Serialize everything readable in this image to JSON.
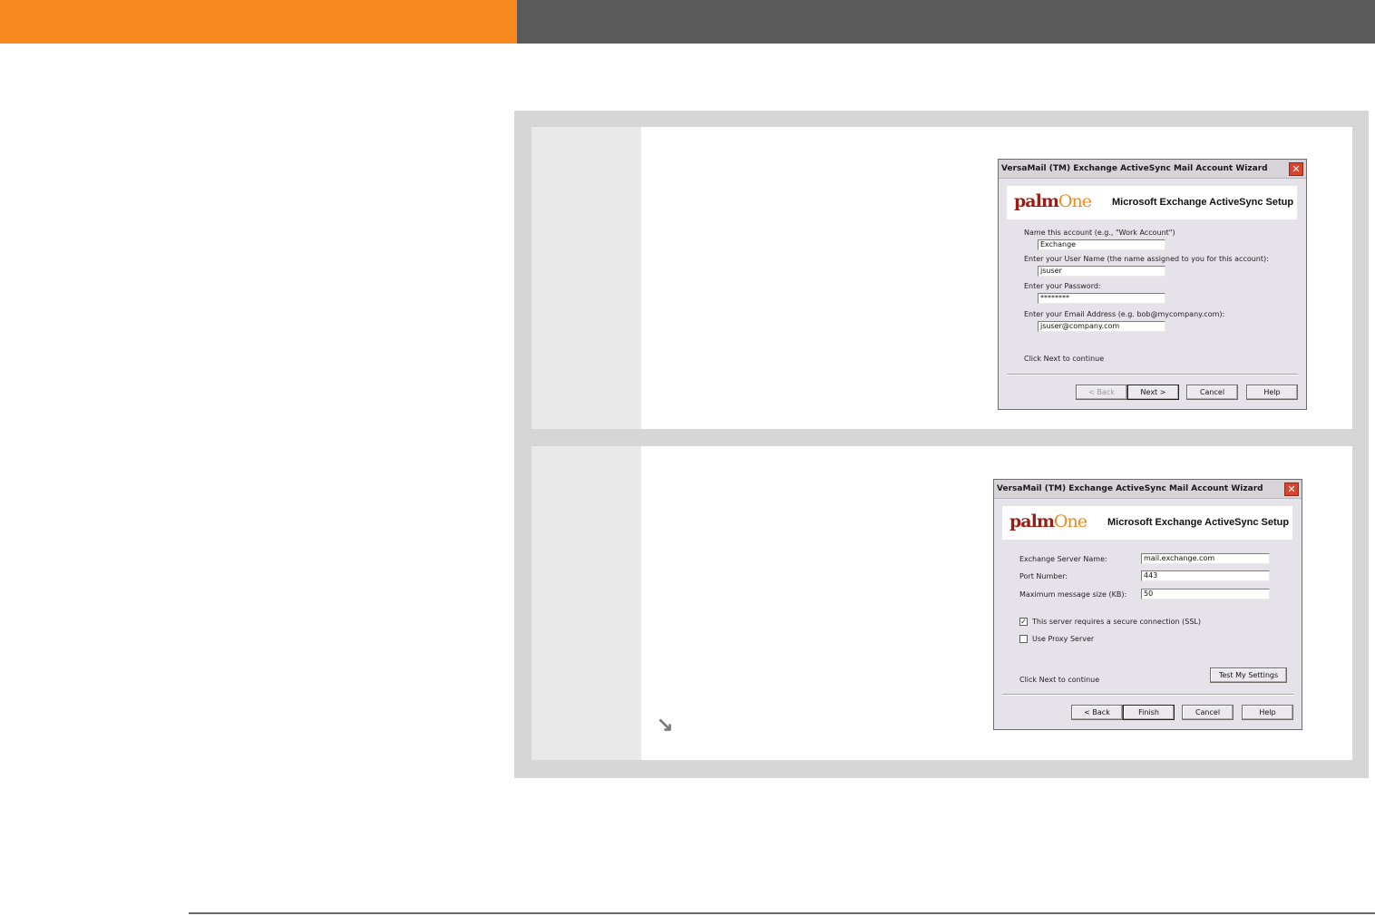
{
  "step1": {
    "dialog": {
      "title": "VersaMail (TM) Exchange ActiveSync Mail Account Wizard",
      "close_glyph": "✕",
      "logo_a": "palm",
      "logo_b": "One",
      "banner_title": "Microsoft Exchange ActiveSync Setup",
      "account_name_label": "Name this account (e.g., \"Work Account\")",
      "account_name_value": "Exchange",
      "username_label": "Enter your User Name (the name assigned to you for this account):",
      "username_value": "jsuser",
      "password_label": "Enter your Password:",
      "password_value": "********",
      "email_label": "Enter your Email Address (e.g. bob@mycompany.com):",
      "email_value": "jsuser@company.com",
      "hint": "Click Next to continue",
      "back_label": "< Back",
      "next_label": "Next >",
      "cancel_label": "Cancel",
      "help_label": "Help"
    }
  },
  "step2": {
    "arrow_glyph": "↘",
    "dialog": {
      "title": "VersaMail (TM) Exchange ActiveSync Mail Account Wizard",
      "close_glyph": "✕",
      "logo_a": "palm",
      "logo_b": "One",
      "banner_title": "Microsoft Exchange ActiveSync Setup",
      "server_label": "Exchange Server Name:",
      "server_value": "mail.exchange.com",
      "port_label": "Port Number:",
      "port_value": "443",
      "maxsize_label": "Maximum message size (KB):",
      "maxsize_value": "50",
      "ssl_label": "This server requires a secure connection (SSL)",
      "ssl_checked": true,
      "ssl_glyph": "✓",
      "proxy_label": "Use Proxy Server",
      "proxy_checked": false,
      "hint": "Click Next to continue",
      "test_label": "Test My Settings",
      "back_label": "< Back",
      "finish_label": "Finish",
      "cancel_label": "Cancel",
      "help_label": "Help"
    }
  },
  "colors": {
    "header_orange": "#f7881f",
    "header_gray": "#5b5b5b",
    "logo_red": "#9b1c12",
    "logo_orange": "#f08a1e"
  }
}
